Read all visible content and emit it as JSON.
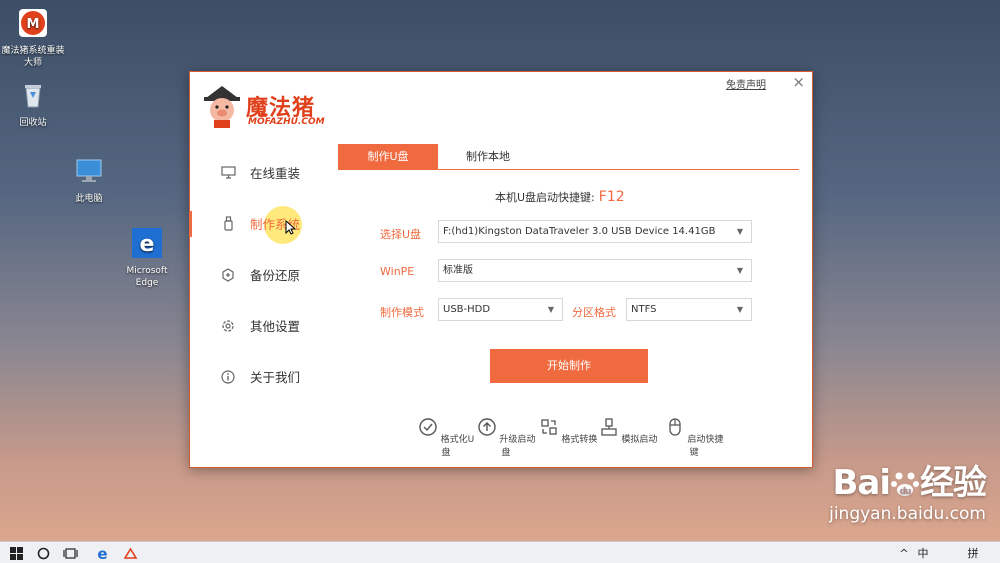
{
  "desktop": {
    "icons": [
      {
        "label": "魔法猪系统重装大师"
      },
      {
        "label": "回收站"
      },
      {
        "label": "此电脑"
      },
      {
        "label": "Microsoft Edge"
      }
    ]
  },
  "window": {
    "disclaimer": "免责声明",
    "close": "×",
    "logo_text": "魔法猪",
    "logo_sub": "MOFAZHU.COM",
    "nav": [
      {
        "label": "在线重装",
        "icon": "monitor-icon"
      },
      {
        "label": "制作系统",
        "icon": "usb-icon"
      },
      {
        "label": "备份还原",
        "icon": "backup-icon"
      },
      {
        "label": "其他设置",
        "icon": "gear-icon"
      },
      {
        "label": "关于我们",
        "icon": "info-icon"
      }
    ],
    "tabs": [
      "制作U盘",
      "制作本地"
    ],
    "hotkey_label": "本机U盘启动快捷键:",
    "hotkey_value": "F12",
    "select_usb_label": "选择U盘",
    "select_usb_value": "F:(hd1)Kingston DataTraveler 3.0 USB Device 14.41GB",
    "winpe_label": "WinPE",
    "winpe_value": "标准版",
    "mode_label": "制作模式",
    "mode_value": "USB-HDD",
    "partition_label": "分区格式",
    "partition_value": "NTFS",
    "start_button": "开始制作",
    "tools": [
      {
        "label": "格式化U盘",
        "icon": "check-circle-icon"
      },
      {
        "label": "升级启动盘",
        "icon": "upgrade-icon"
      },
      {
        "label": "格式转换",
        "icon": "convert-icon"
      },
      {
        "label": "模拟启动",
        "icon": "simulate-icon"
      },
      {
        "label": "启动快捷键",
        "icon": "mouse-icon"
      }
    ]
  },
  "watermark": {
    "brand": "Bai",
    "brand_cn": "经验",
    "url": "jingyan.baidu.com"
  },
  "taskbar": {
    "ime": "中",
    "ime2": "拼"
  },
  "colors": {
    "accent": "#f06a3f",
    "logo": "#e0401b"
  }
}
